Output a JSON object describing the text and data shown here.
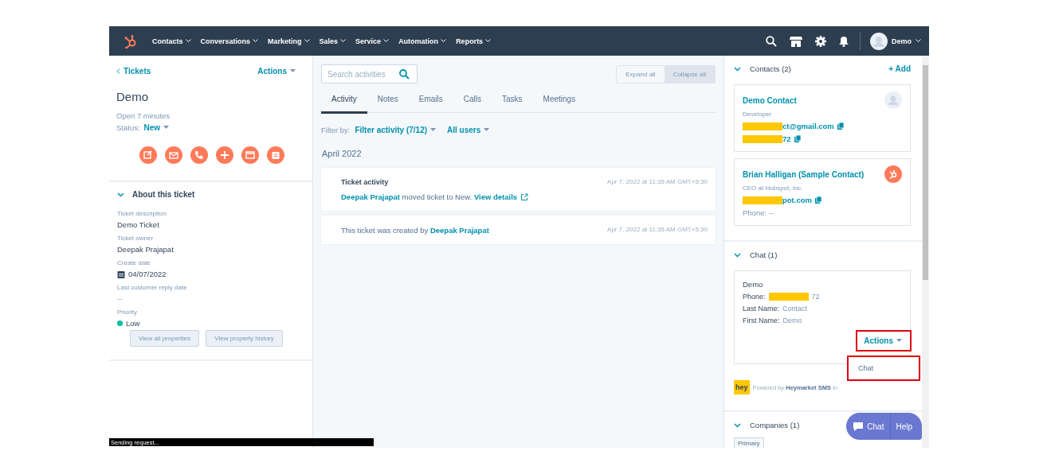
{
  "nav": {
    "items": [
      "Contacts",
      "Conversations",
      "Marketing",
      "Sales",
      "Service",
      "Automation",
      "Reports"
    ],
    "user": "Demo"
  },
  "ticket": {
    "back": "Tickets",
    "actions": "Actions",
    "title": "Demo",
    "open_for": "Open 7 minutes",
    "status_label": "Status:",
    "status": "New",
    "section": {
      "title": "About this ticket",
      "expanded": true
    },
    "properties": [
      {
        "kind": "text",
        "label": "Ticket description",
        "value": "Demo Ticket"
      },
      {
        "kind": "text",
        "label": "Ticket owner",
        "value": "Deepak Prajapat"
      },
      {
        "kind": "date",
        "label": "Create date",
        "value": "04/07/2022"
      },
      {
        "kind": "empty",
        "label": "Last customer reply date",
        "value": "--"
      },
      {
        "kind": "priority",
        "label": "Priority",
        "value": "Low",
        "color": "#00bda5"
      }
    ],
    "buttons": [
      "View all properties",
      "View property history"
    ]
  },
  "activity": {
    "search": {
      "placeholder": "Search activities"
    },
    "toggles": [
      {
        "label": "Expand all",
        "selected": false
      },
      {
        "label": "Collapse all",
        "selected": true
      }
    ],
    "tabs": [
      {
        "label": "Activity",
        "selected": true
      },
      {
        "label": "Notes",
        "selected": false
      },
      {
        "label": "Emails",
        "selected": false
      },
      {
        "label": "Calls",
        "selected": false
      },
      {
        "label": "Tasks",
        "selected": false
      },
      {
        "label": "Meetings",
        "selected": false
      }
    ],
    "filter_label": "Filter by:",
    "filters": [
      "Filter activity (7/12)",
      "All users"
    ],
    "month": "April 2022",
    "items": [
      {
        "kind": "change",
        "title": "Ticket activity",
        "time": "Apr 7, 2022 at 11:35 AM GMT+5:30",
        "actor": "Deepak Prajapat",
        "text": "moved ticket to New.",
        "link": "View details"
      },
      {
        "kind": "created",
        "time": "Apr 7, 2022 at 11:35 AM GMT+5:30",
        "text": "This ticket was created by",
        "actor": "Deepak Prajapat"
      }
    ]
  },
  "sidebar": {
    "contacts": {
      "title": "Contacts (2)",
      "expanded": true,
      "add": "+ Add",
      "cards": [
        {
          "name": "Demo Contact",
          "role": "Developer",
          "kind": "person",
          "lines": [
            {
              "kind": "link",
              "text": "ct@gmail.com",
              "redacted": true
            },
            {
              "kind": "link",
              "text": "72",
              "redacted": true
            }
          ]
        },
        {
          "name": "Brian Halligan (Sample Contact)",
          "role": "CEO at Hubspot, Inc.",
          "kind": "logo",
          "lines": [
            {
              "kind": "link",
              "text": "pot.com",
              "redacted": true
            },
            {
              "kind": "plain",
              "text": "Phone: --",
              "redacted": false
            }
          ]
        }
      ]
    },
    "chat": {
      "title": "Chat (1)",
      "expanded": true,
      "card": {
        "name": "Demo",
        "fields": [
          {
            "label": "Phone:",
            "value": "72",
            "redacted": true
          },
          {
            "label": "Last Name:",
            "value": "Contact",
            "redacted": false
          },
          {
            "label": "First Name:",
            "value": "Demo",
            "redacted": false
          }
        ],
        "actions": "Actions"
      },
      "menu": [
        "Chat"
      ],
      "logo": "hey",
      "powered": "Powered by **Heymarket SMS** In"
    },
    "companies": {
      "title": "Companies (1)",
      "expanded": true,
      "tag": "Primary"
    }
  },
  "widget": {
    "chat": "Chat",
    "help": "Help"
  },
  "status_bar": "Sending request..."
}
